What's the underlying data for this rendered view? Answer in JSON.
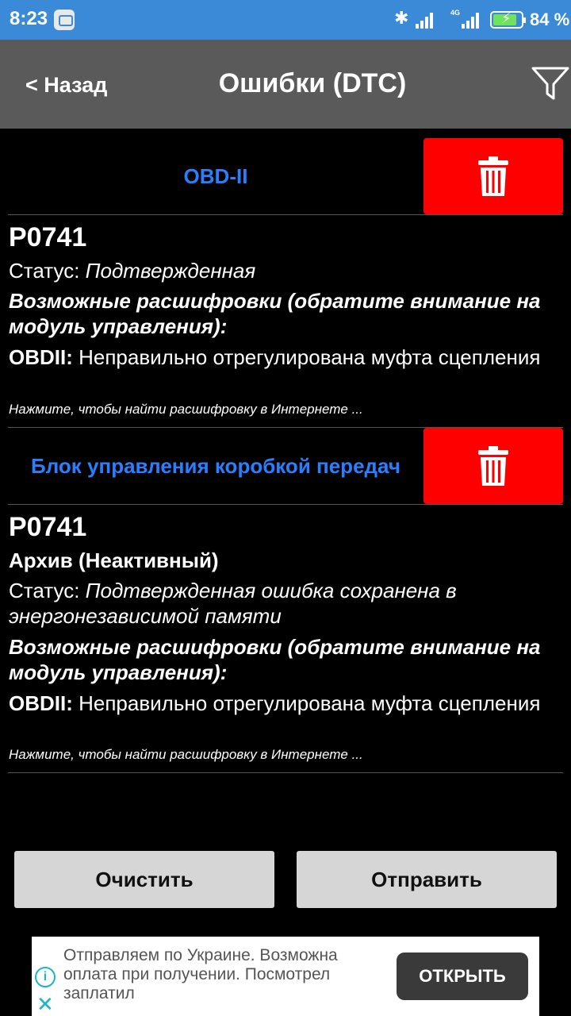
{
  "status_bar": {
    "time": "8:23",
    "lte_label": "4G",
    "battery_percent": "84 %",
    "battery_level": 84
  },
  "header": {
    "back_label": "< Назад",
    "title": "Ошибки (DTC)",
    "filter_icon": "filter-icon"
  },
  "sections": [
    {
      "name": "OBD-II",
      "entries": [
        {
          "code": "P0741",
          "status_label": "Статус: ",
          "status_value": "Подтвержденная",
          "decode_title": "Возможные расшифровки (обратите внимание на модуль управления):",
          "decode_prefix": "OBDII:",
          "decode_text": " Неправильно отрегулирована муфта сцепления",
          "hint": "Нажмите, чтобы найти расшифровку в Интернете ..."
        }
      ]
    },
    {
      "name": "Блок управления коробкой передач",
      "entries": [
        {
          "code": "P0741",
          "archive": "Архив (Неактивный)",
          "status_label": "Статус: ",
          "status_value": "Подтвержденная ошибка сохранена в энергонезависимой памяти",
          "decode_title": "Возможные расшифровки (обратите внимание на модуль управления):",
          "decode_prefix": "OBDII:",
          "decode_text": " Неправильно отрегулирована муфта сцепления",
          "hint": "Нажмите, чтобы найти расшифровку в Интернете ..."
        }
      ]
    }
  ],
  "buttons": {
    "clear": "Очистить",
    "send": "Отправить"
  },
  "ad": {
    "text": "Отправляем по Украине. Возможна оплата при получении. Посмотрел заплатил",
    "open_label": "ОТКРЫТЬ",
    "info_glyph": "i",
    "close_glyph": "✕"
  },
  "colors": {
    "status_bar": "#3b8ad8",
    "header": "#5a5a5a",
    "section_title": "#2a7fff",
    "delete_button": "#ff0000",
    "action_button": "#d6d6d6"
  }
}
